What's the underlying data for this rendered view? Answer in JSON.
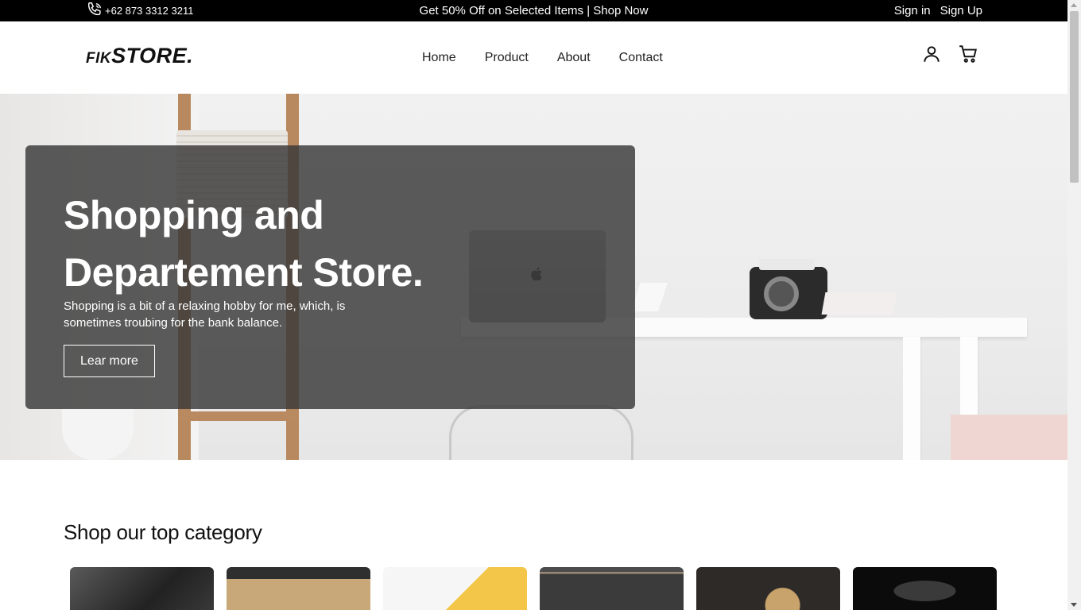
{
  "topbar": {
    "phone": "+62 873 3312 3211",
    "promo": "Get 50% Off on Selected Items | Shop Now",
    "sign_in": "Sign in",
    "sign_up": "Sign Up"
  },
  "header": {
    "logo_small": "FIK",
    "logo_big": "STORE.",
    "nav": [
      "Home",
      "Product",
      "About",
      "Contact"
    ],
    "icons": [
      "user-icon",
      "cart-icon"
    ]
  },
  "hero": {
    "title": "Shopping and Departement Store.",
    "subtitle": "Shopping is a bit of a relaxing hobby for me, which, is sometimes troubing for the bank balance.",
    "button": "Lear more"
  },
  "categories": {
    "title": "Shop our top category"
  },
  "colors": {
    "topbar_bg": "#000000",
    "hero_card_bg": "#383838",
    "text": "#111111"
  }
}
